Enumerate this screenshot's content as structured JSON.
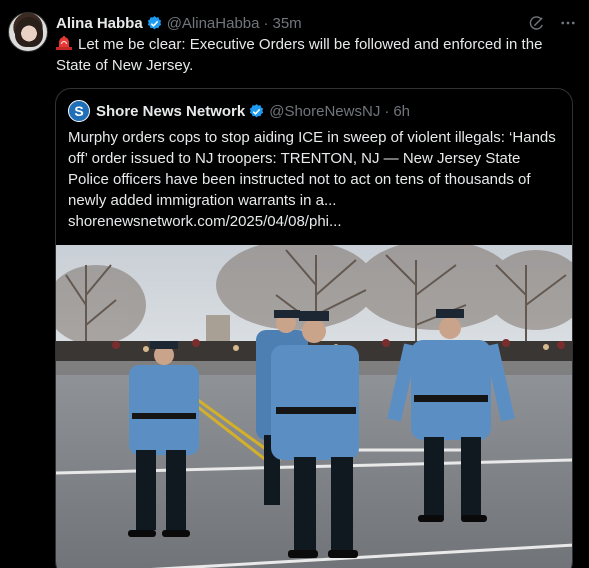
{
  "tweet": {
    "author_name": "Alina Habba",
    "handle": "@AlinaHabba",
    "time": "35m",
    "text": "Let me be clear: Executive Orders will be followed and enforced in the State of New Jersey."
  },
  "quote": {
    "author_name": "Shore News Network",
    "handle": "@ShoreNewsNJ",
    "time": "6h",
    "text": "Murphy orders cops to stop aiding ICE in sweep of violent illegals: ‘Hands off’ order issued to NJ troopers: TRENTON, NJ — New Jersey State Police officers have been instructed not to act on tens of thousands of newly added immigration warrants in a... shorenewsnetwork.com/2025/04/08/phi..."
  },
  "icons": {
    "verified": "verified-badge-icon",
    "siren": "siren-icon",
    "grok": "grok-icon",
    "more": "more-icon"
  },
  "colors": {
    "background": "#000000",
    "text": "#e7e9ea",
    "muted": "#71767b",
    "verified": "#1d9bf0",
    "border": "#2f3336",
    "uniform": "#5b8fc4"
  }
}
